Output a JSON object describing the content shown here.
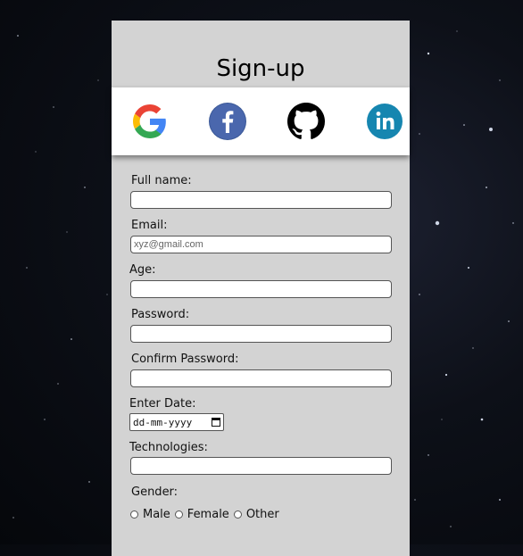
{
  "form": {
    "title": "Sign-up",
    "social": [
      {
        "icon": "google-icon"
      },
      {
        "icon": "facebook-icon"
      },
      {
        "icon": "github-icon"
      },
      {
        "icon": "linkedin-icon"
      }
    ],
    "fields": {
      "full_name": {
        "label": "Full name:",
        "value": "",
        "placeholder": ""
      },
      "email": {
        "label": "Email:",
        "value": "",
        "placeholder": "xyz@gmail.com"
      },
      "age": {
        "label": "Age:",
        "value": "",
        "placeholder": ""
      },
      "password": {
        "label": "Password:",
        "value": "",
        "placeholder": ""
      },
      "confirm_password": {
        "label": "Confirm Password:",
        "value": "",
        "placeholder": ""
      },
      "date": {
        "label": "Enter Date:",
        "placeholder": "dd-mm-yyyy"
      },
      "technologies": {
        "label": "Technologies:",
        "value": "",
        "placeholder": ""
      }
    },
    "gender": {
      "label": "Gender:",
      "options": [
        "Male",
        "Female",
        "Other"
      ]
    }
  },
  "colors": {
    "panel": "#d3d3d3",
    "facebook": "#3b5998",
    "linkedin": "#0e76a8",
    "github": "#000000"
  }
}
